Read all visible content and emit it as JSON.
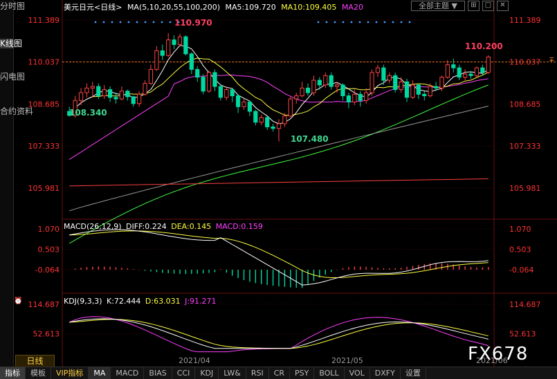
{
  "sidebar": {
    "tabs": [
      "分时图",
      "K线图",
      "闪电图",
      "合约资料"
    ]
  },
  "header": {
    "symbol": "美元日元<日线>",
    "ma_label": "MA(5,10,20,55,100,200)",
    "ma5": "MA5:109.720",
    "ma10": "MA10:109.405",
    "ma20": "MA20",
    "theme_button": "全部主题",
    "theme_arrow": "▼",
    "window_buttons": [
      "⊞",
      "□",
      "✕"
    ]
  },
  "colors": {
    "up": "#ff4444",
    "down": "#00d8a0",
    "ma5": "#ffffff",
    "ma10": "#ffff40",
    "ma20": "#ff40ff",
    "ma55": "#40ff40",
    "ma100": "#9a9a9a",
    "ma200": "#ff4040",
    "axis_text": "#ff3333",
    "grid": "#8a1a1a",
    "dif": "#ffffff",
    "dea": "#ffff40",
    "macd": "#ff40ff",
    "k": "#ffffff",
    "d": "#ffff40",
    "j": "#ff40ff"
  },
  "main_axis": {
    "ticks": [
      "111.389",
      "110.037",
      "108.685",
      "107.333",
      "105.981"
    ],
    "current": "110.037",
    "current_marker": "∓"
  },
  "annotations": {
    "high": "110.970",
    "low1": "108.340",
    "low2": "107.480",
    "last": "110.200"
  },
  "macd": {
    "label": "MACD(26,12,9)",
    "diff": "DIFF:0.224",
    "dea": "DEA:0.145",
    "macd": "MACD:0.159",
    "ticks": [
      "1.070",
      "0.503",
      "-0.064"
    ]
  },
  "kdj": {
    "label": "KDJ(9,3,3)",
    "k": "K:72.444",
    "d": "D:63.031",
    "j": "J:91.271",
    "ticks": [
      "114.687",
      "52.613"
    ]
  },
  "x_axis": {
    "labels": [
      "2021/04",
      "2021/05",
      "2021/06"
    ]
  },
  "period_button": "日线",
  "bottom_tabs": [
    "指标",
    "模板",
    "VIP指标",
    "MA",
    "MACD",
    "BIAS",
    "CCI",
    "KDJ",
    "LW&",
    "RSI",
    "CR",
    "PSY",
    "BOLL",
    "VOL",
    "DXFY",
    "设置"
  ],
  "watermark": "FX678",
  "chart_data": {
    "type": "candlestick",
    "ylim": [
      105.0,
      111.7
    ],
    "yticks": [
      111.389,
      110.037,
      108.685,
      107.333,
      105.981
    ],
    "candles": [
      [
        108.45,
        108.32,
        108.6,
        108.28
      ],
      [
        108.32,
        108.8,
        108.95,
        108.25
      ],
      [
        108.8,
        109.05,
        109.2,
        108.65
      ],
      [
        109.05,
        109.2,
        109.35,
        108.9
      ],
      [
        109.2,
        109.25,
        109.4,
        108.9
      ],
      [
        109.25,
        108.95,
        109.35,
        108.85
      ],
      [
        108.95,
        109.15,
        109.3,
        108.85
      ],
      [
        109.15,
        108.9,
        109.25,
        108.75
      ],
      [
        108.9,
        108.85,
        109.05,
        108.7
      ],
      [
        108.85,
        109.1,
        109.25,
        108.8
      ],
      [
        109.1,
        108.92,
        109.15,
        108.8
      ],
      [
        108.92,
        108.7,
        108.95,
        108.6
      ],
      [
        108.7,
        109.0,
        109.1,
        108.6
      ],
      [
        109.0,
        109.35,
        109.45,
        108.95
      ],
      [
        109.35,
        109.8,
        109.95,
        109.3
      ],
      [
        109.8,
        110.4,
        110.55,
        109.75
      ],
      [
        110.4,
        110.25,
        110.6,
        110.1
      ],
      [
        110.25,
        110.75,
        110.97,
        110.2
      ],
      [
        110.75,
        110.6,
        110.9,
        110.45
      ],
      [
        110.6,
        110.85,
        110.95,
        110.55
      ],
      [
        110.85,
        110.3,
        110.9,
        110.25
      ],
      [
        110.3,
        109.8,
        110.35,
        109.65
      ],
      [
        109.8,
        109.55,
        109.9,
        109.4
      ],
      [
        109.55,
        109.1,
        109.65,
        109.0
      ],
      [
        109.1,
        109.7,
        109.75,
        109.05
      ],
      [
        109.7,
        109.25,
        109.8,
        109.1
      ],
      [
        109.25,
        108.9,
        109.3,
        108.8
      ],
      [
        108.9,
        109.15,
        109.25,
        108.8
      ],
      [
        109.15,
        108.95,
        109.2,
        108.75
      ],
      [
        108.95,
        108.6,
        109.0,
        108.4
      ],
      [
        108.6,
        108.75,
        108.85,
        108.5
      ],
      [
        108.75,
        108.45,
        108.8,
        108.3
      ],
      [
        108.45,
        108.1,
        108.5,
        108.0
      ],
      [
        108.1,
        108.25,
        108.35,
        108.0
      ],
      [
        108.25,
        107.95,
        108.3,
        107.85
      ],
      [
        107.95,
        107.9,
        108.05,
        107.8
      ],
      [
        107.9,
        108.05,
        108.2,
        107.48
      ],
      [
        108.05,
        108.3,
        108.4,
        107.95
      ],
      [
        108.3,
        108.85,
        108.95,
        108.25
      ],
      [
        108.85,
        108.95,
        109.05,
        108.7
      ],
      [
        108.95,
        109.2,
        109.4,
        108.9
      ],
      [
        109.2,
        109.05,
        109.35,
        108.95
      ],
      [
        109.05,
        109.45,
        109.6,
        108.95
      ],
      [
        109.45,
        109.3,
        109.55,
        109.15
      ],
      [
        109.3,
        109.6,
        109.7,
        109.2
      ],
      [
        109.6,
        109.25,
        109.7,
        109.15
      ],
      [
        109.25,
        109.3,
        109.4,
        109.05
      ],
      [
        109.3,
        108.95,
        109.35,
        108.8
      ],
      [
        108.95,
        108.75,
        109.05,
        108.55
      ],
      [
        108.75,
        109.0,
        109.15,
        108.65
      ],
      [
        109.0,
        108.8,
        109.1,
        108.6
      ],
      [
        108.8,
        109.05,
        109.2,
        108.7
      ],
      [
        109.05,
        109.7,
        109.8,
        108.95
      ],
      [
        109.7,
        109.85,
        109.95,
        109.55
      ],
      [
        109.85,
        109.45,
        109.95,
        109.3
      ],
      [
        109.45,
        109.6,
        109.7,
        109.35
      ],
      [
        109.6,
        109.15,
        109.7,
        109.05
      ],
      [
        109.15,
        109.4,
        109.55,
        109.05
      ],
      [
        109.4,
        108.9,
        109.5,
        108.75
      ],
      [
        108.9,
        109.3,
        109.45,
        108.85
      ],
      [
        109.3,
        109.0,
        109.35,
        108.85
      ],
      [
        109.0,
        108.95,
        109.1,
        108.8
      ],
      [
        108.95,
        109.25,
        109.35,
        108.9
      ],
      [
        109.25,
        109.2,
        109.4,
        109.1
      ],
      [
        109.2,
        109.55,
        109.6,
        109.1
      ],
      [
        109.55,
        109.95,
        110.1,
        109.5
      ],
      [
        109.95,
        109.85,
        110.15,
        109.7
      ],
      [
        109.85,
        109.55,
        109.95,
        109.45
      ],
      [
        109.55,
        109.65,
        109.8,
        109.45
      ],
      [
        109.65,
        109.6,
        109.75,
        109.5
      ],
      [
        109.6,
        109.85,
        109.9,
        109.55
      ],
      [
        109.85,
        109.7,
        109.95,
        109.6
      ],
      [
        109.7,
        110.2,
        110.25,
        109.65
      ]
    ],
    "ma100": {
      "start": 105.25,
      "end": 108.62
    },
    "ma200": {
      "start": 106.3,
      "end": 106.25
    },
    "macd_ylim": [
      -0.7,
      1.3
    ],
    "kdj_ylim": [
      10,
      135
    ],
    "x_label_index": [
      27,
      57,
      84
    ]
  }
}
